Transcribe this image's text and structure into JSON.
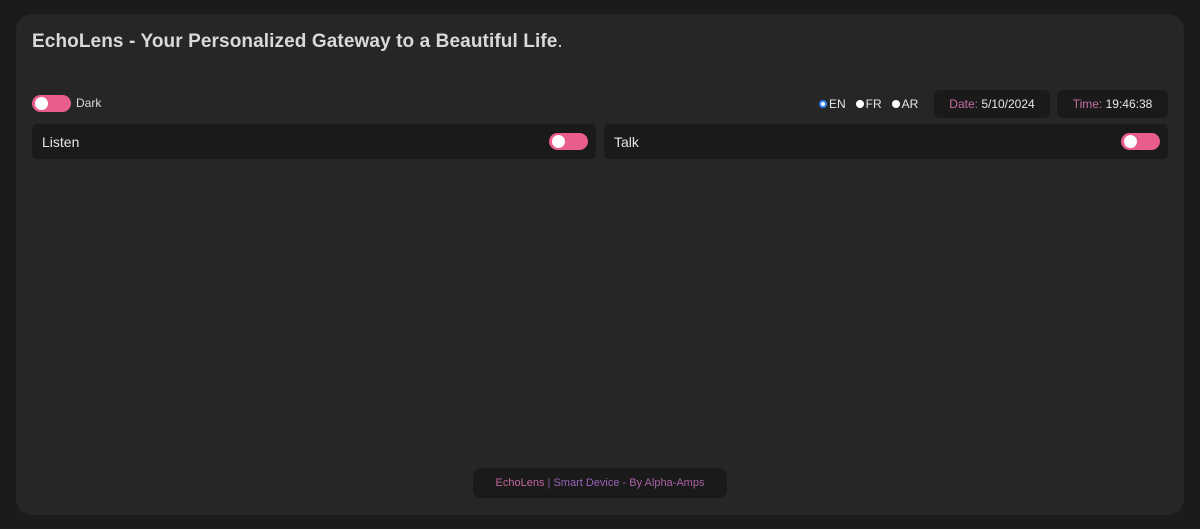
{
  "header": {
    "title_brand": "EchoLens",
    "title_rest": " - Your Personalized Gateway to a Beautiful Life",
    "title_end": "."
  },
  "theme": {
    "label": "Dark",
    "enabled": true
  },
  "languages": {
    "options": [
      {
        "code": "EN",
        "selected": true
      },
      {
        "code": "FR",
        "selected": false
      },
      {
        "code": "AR",
        "selected": false
      }
    ]
  },
  "date": {
    "label": "Date:",
    "value": "5/10/2024"
  },
  "time": {
    "label": "Time:",
    "value": "19:46:38"
  },
  "panels": {
    "listen": {
      "label": "Listen",
      "enabled": true
    },
    "talk": {
      "label": "Talk",
      "enabled": true
    }
  },
  "footer": {
    "brand": "EchoLens",
    "separator": " | ",
    "product": "Smart Device",
    "by": " - By Alpha-Amps"
  },
  "colors": {
    "accent": "#e85d8c",
    "label_accent": "#c76ea0",
    "radio_selected": "#2f7fff"
  }
}
